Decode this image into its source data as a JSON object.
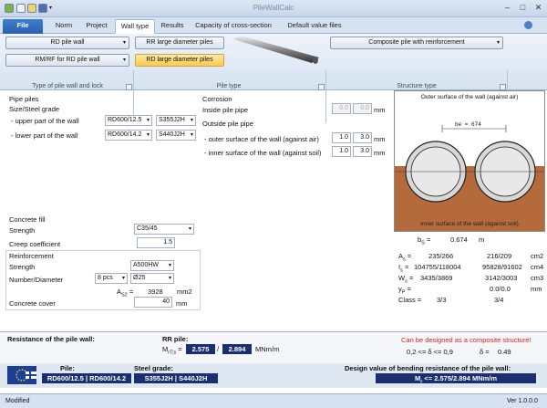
{
  "app": {
    "title": "PileWallCalc"
  },
  "tabs": [
    "File",
    "Norm",
    "Project",
    "Wall type",
    "Results",
    "Capacity of cross-section",
    "Default value files"
  ],
  "active_tab": "Wall type",
  "ribbon": {
    "group1": {
      "btn1": "RD pile wall",
      "btn2": "RM/RF for RD pile wall",
      "label": "Type of pile wall and lock"
    },
    "group2": {
      "btn1": "RR large diameter piles",
      "btn2": "RD large diameter piles",
      "label": "Pile type"
    },
    "group3": {
      "btn1": "Composite pile with reinforcement",
      "label": "Structure type"
    }
  },
  "pipe_piles": {
    "title": "Pipe piles",
    "size_grade": "Size/Steel grade",
    "upper_label": "- upper part of the wall",
    "upper_size": "RD600/12.5",
    "upper_grade": "S355J2H",
    "lower_label": "- lower part of the wall",
    "lower_size": "RD600/14.2",
    "lower_grade": "S440J2H"
  },
  "corrosion": {
    "title": "Corrosion",
    "inside_label": "Inside pile pipe",
    "inside_v1": "0.0",
    "inside_v2": "0.0",
    "outside_title": "Outside pile pipe",
    "outer_label": "- outer surface of the wall (against air)",
    "outer_v1": "1.0",
    "outer_v2": "3.0",
    "inner_label": "- inner surface of the wall (against soil)",
    "inner_v1": "1.0",
    "inner_v2": "3.0",
    "unit": "mm"
  },
  "concrete": {
    "title": "Concrete fill",
    "strength_label": "Strength",
    "strength_value": "C35/45",
    "creep_label": "Creep coefficient",
    "creep_value": "1.5"
  },
  "reinforcement": {
    "title": "Reinforcement",
    "strength_label": "Strength",
    "strength_value": "A500HW",
    "number_label": "Number/Diameter",
    "number_value": "8 pcs",
    "diameter_value": "Ø25",
    "as2_label": "A",
    "as2_sub": "S2",
    "as2_eq": "=",
    "as2_value": "3928",
    "as2_unit": "mm2",
    "cover_label": "Concrete cover",
    "cover_value": "40",
    "cover_unit": "mm"
  },
  "structure": {
    "top_label": "Outer surface of the wall (against air)",
    "bottom_label": "Inner surface of the wall (against soil)",
    "be_label": "be = 674",
    "bs_label": "b",
    "bs_sub": "S",
    "bs_eq": "=",
    "bs_value": "0.674",
    "bs_unit": "m",
    "rows": [
      {
        "label": "A",
        "sub": "s",
        "eq": "=",
        "v1": "235/266",
        "v2": "216/209",
        "unit": "cm2"
      },
      {
        "label": "I",
        "sub": "s",
        "eq": "=",
        "v1": "104755/118004",
        "v2": "95828/91602",
        "unit": "cm4"
      },
      {
        "label": "W",
        "sub": "s",
        "eq": "=",
        "v1": "3435/3869",
        "v2": "3142/3003",
        "unit": "cm3"
      },
      {
        "label": "y",
        "sub": "P",
        "eq": "=",
        "v1": "",
        "v2": "0.0/0.0",
        "unit": "mm"
      },
      {
        "label": "Class",
        "sub": "",
        "eq": "=",
        "v1": "3/3",
        "v2": "3/4",
        "unit": ""
      }
    ]
  },
  "result": {
    "title": "Resistance of the pile wall:",
    "rr_title": "RR pile:",
    "m_label": "M",
    "m_sub": "rT;s",
    "m_eq": "=",
    "m_value1": "2.575",
    "m_sep": "/",
    "m_value2": "2.894",
    "m_unit": "MNm/m",
    "red_note": "Can be designed as a composite structure!",
    "delta_range": "0,2 <=   δ   <= 0,9",
    "delta_label": "δ =",
    "delta_value": "0.49"
  },
  "bottom": {
    "pile_label": "Pile:",
    "pile_value": "RD600/12.5 | RD600/14.2",
    "grade_label": "Steel grade:",
    "grade_value": "S355J2H | S440J2H",
    "design_label": "Design value of bending resistance of the pile wall:",
    "design_value": "M",
    "design_sub": "r",
    "design_rest": " <= 2.575/2.894 MNm/m"
  },
  "status": {
    "left": "Modified",
    "right": "Ver 1.0.0.0"
  },
  "colors": {
    "accent": "#2a5fae",
    "selected": "#f8c955",
    "soil": "#b46a3b",
    "navy": "#1b2e6e",
    "red": "#e0201f"
  }
}
